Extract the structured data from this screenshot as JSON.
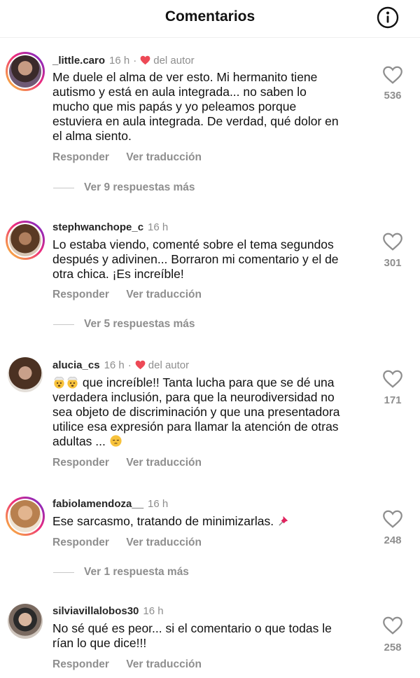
{
  "header": {
    "title": "Comentarios",
    "info_icon": "info-circle-icon"
  },
  "comments": [
    {
      "username": "_little.caro",
      "time": "16 h",
      "separator": "·",
      "author_badge": "del autor",
      "lines": [
        "Me duele el alma de ver esto. Mi hermanito tiene",
        "autismo y está en aula integrada... no saben lo",
        "mucho que mis papás y yo peleamos porque",
        "estuviera en aula integrada. De verdad, qué dolor en",
        "el alma siento."
      ],
      "reply_label": "Responder",
      "translate_label": "Ver traducción",
      "more_replies": "Ver 9 respuestas más",
      "likes": "536"
    },
    {
      "username": "stephwanchope_c",
      "time": "16 h",
      "lines": [
        "Lo estaba viendo, comenté sobre el tema segundos",
        "después y adivinen... Borraron mi comentario y el de",
        "otra chica. ¡Es increíble!"
      ],
      "reply_label": "Responder",
      "translate_label": "Ver traducción",
      "more_replies": "Ver 5 respuestas más",
      "likes": "301"
    },
    {
      "username": "alucia_cs",
      "time": "16 h",
      "separator": "·",
      "author_badge": "del autor",
      "line1_text": " que increíble!! Tanta lucha para que se dé una",
      "lines": [
        "verdadera inclusión, para que la neurodiversidad no",
        "sea objeto de discriminación y que una presentadora",
        "utilice esa expresión para llamar la atención de otras"
      ],
      "last_line_text": "adultas ... ",
      "reply_label": "Responder",
      "translate_label": "Ver traducción",
      "likes": "171"
    },
    {
      "username": "fabiolamendoza__",
      "time": "16 h",
      "text": "Ese sarcasmo, tratando de minimizarlas. ",
      "reply_label": "Responder",
      "translate_label": "Ver traducción",
      "more_replies": "Ver 1 respuesta más",
      "likes": "248"
    },
    {
      "username": "silviavillalobos30",
      "time": "16 h",
      "lines": [
        "No sé qué es peor... si el comentario o que todas le",
        "rían lo que dice!!!"
      ],
      "reply_label": "Responder",
      "translate_label": "Ver traducción",
      "likes": "258"
    }
  ],
  "colors": {
    "author_heart": "#ed4956",
    "muted": "#8e8e8e",
    "text": "#111111"
  }
}
